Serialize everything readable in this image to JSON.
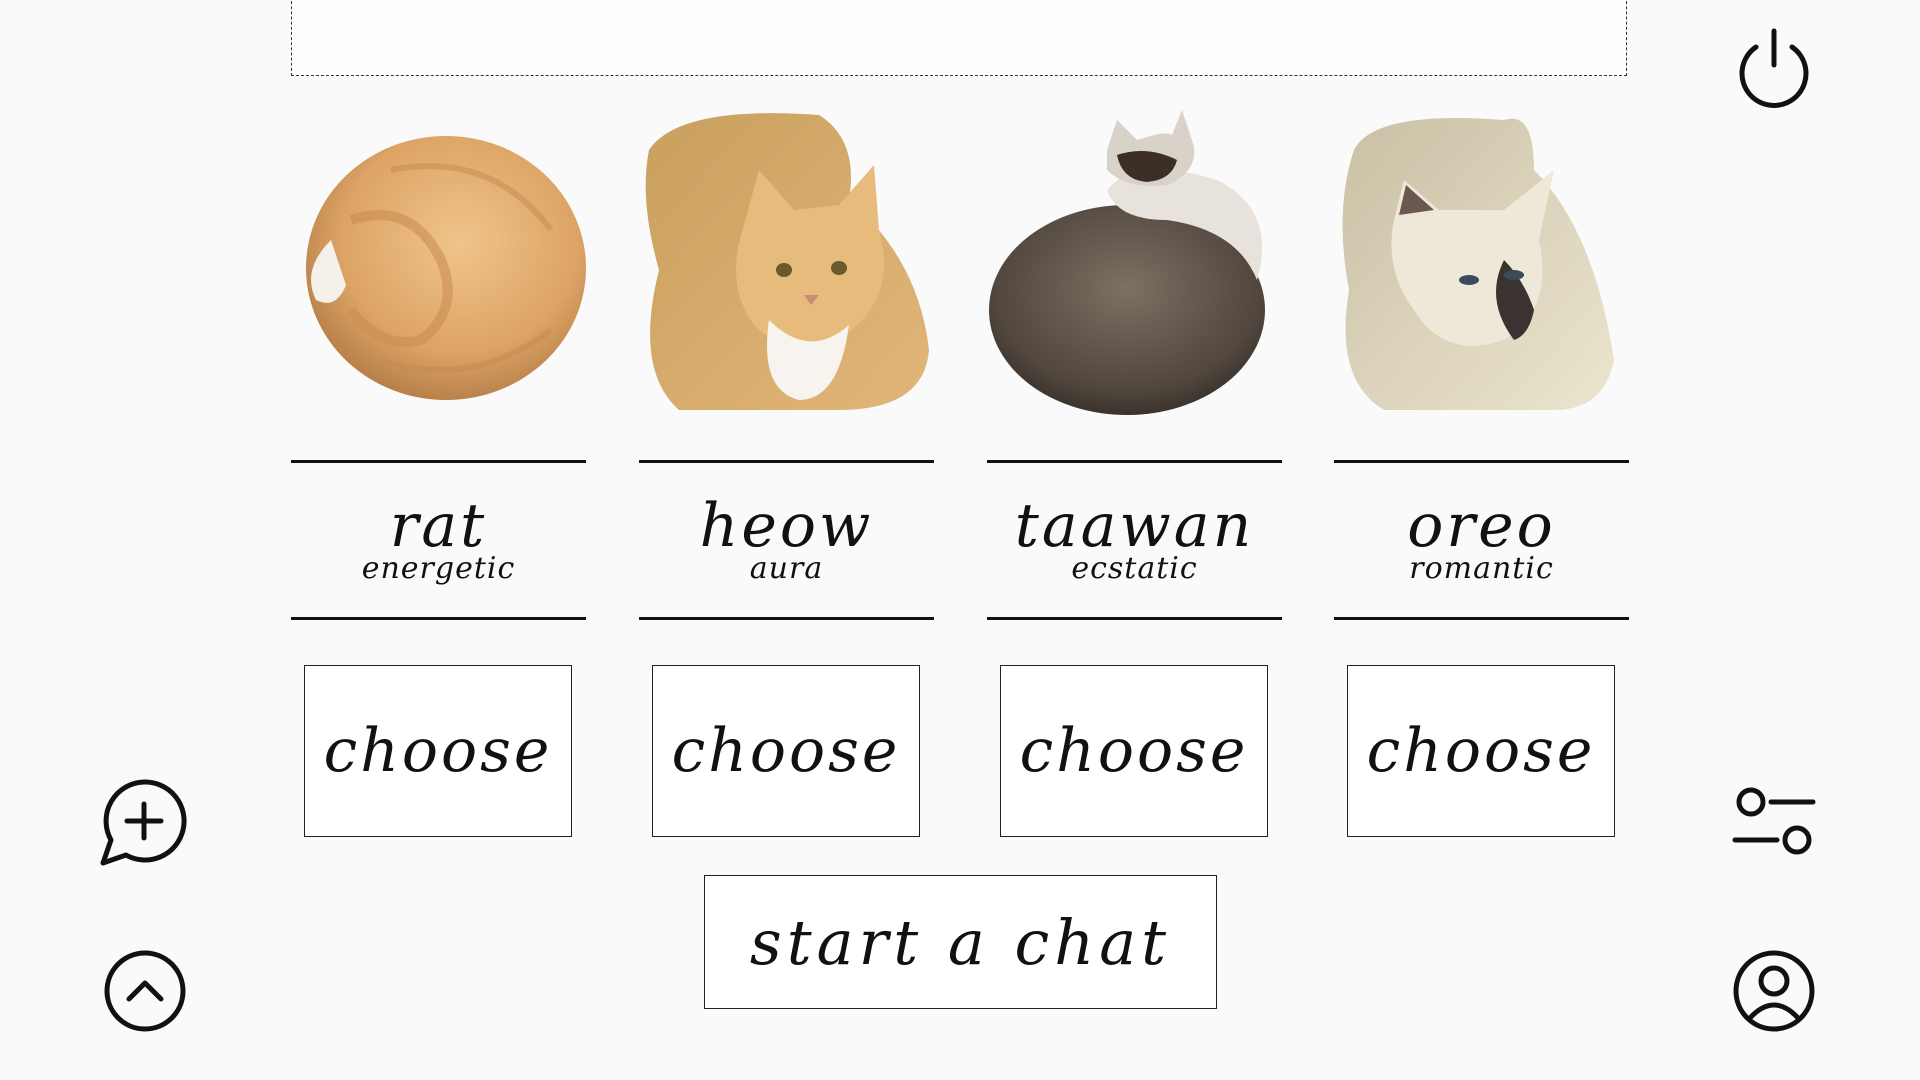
{
  "top_area": {
    "text": ""
  },
  "cats": [
    {
      "name": "rat",
      "trait": "energetic",
      "choose_label": "choose",
      "image": "orange tabby cat curled in a ball"
    },
    {
      "name": "heow",
      "trait": "aura",
      "choose_label": "choose",
      "image": "orange and white cat loafing"
    },
    {
      "name": "taawan",
      "trait": "ecstatic",
      "choose_label": "choose",
      "image": "dark siamese cat curled from behind"
    },
    {
      "name": "oreo",
      "trait": "romantic",
      "choose_label": "choose",
      "image": "siamese cat loafing"
    }
  ],
  "start_chat_label": "start a chat",
  "icons": {
    "power": "power-icon",
    "new_chat": "chat-plus-icon",
    "scroll_up": "chevron-up-circle-icon",
    "settings": "sliders-icon",
    "profile": "user-circle-icon"
  }
}
